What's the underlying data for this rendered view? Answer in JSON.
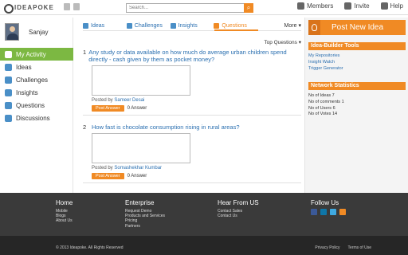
{
  "header": {
    "logo_text": "IDEAPOKE",
    "search_placeholder": "Search...",
    "nav": [
      {
        "label": "Members",
        "icon": "members-icon"
      },
      {
        "label": "Invite",
        "icon": "invite-icon"
      },
      {
        "label": "Help",
        "icon": "help-icon"
      }
    ]
  },
  "sidebar": {
    "username": "Sanjay",
    "items": [
      {
        "label": "My Activity",
        "active": true
      },
      {
        "label": "Ideas"
      },
      {
        "label": "Challenges"
      },
      {
        "label": "Insights"
      },
      {
        "label": "Questions"
      },
      {
        "label": "Discussions"
      }
    ]
  },
  "main": {
    "tabs": [
      "Ideas",
      "Challenges",
      "Insights",
      "Questions",
      "More"
    ],
    "selected_tab": "Questions",
    "sort_label": "Top Questions",
    "questions": [
      {
        "num": "1",
        "title": "Any study or data available on how much do average urban children spend directly - cash given by them as pocket money?",
        "posted_prefix": "Posted by",
        "author": "Sameer Desai",
        "button": "Post Answer",
        "answers": "0 Answer"
      },
      {
        "num": "2",
        "title": "How fast is chocolate consumption rising in rural areas?",
        "posted_prefix": "Posted by",
        "author": "Somashekhar Kumbar",
        "button": "Post Answer",
        "answers": "0 Answer"
      }
    ]
  },
  "right": {
    "post_button": "Post New Idea",
    "tools_title": "Idea-Builder Tools",
    "tools": [
      "My Repositories",
      "Insight Watch",
      "Trigger Generator"
    ],
    "stats_title": "Network Statistics",
    "stats": [
      "No of Ideas 7",
      "No of comments 1",
      "No of Users 6",
      "No of Votes 14"
    ]
  },
  "footer": {
    "home": {
      "title": "Home",
      "links": [
        "Mobile",
        "Blogs",
        "About Us"
      ]
    },
    "enterprise": {
      "title": "Enterprise",
      "links": [
        "Request Demo",
        "Products and Services",
        "Pricing",
        "Partners"
      ]
    },
    "hear": {
      "title": "Hear From US",
      "links": [
        "Contact Sales",
        "Contact Us"
      ]
    },
    "follow": {
      "title": "Follow Us",
      "social": [
        "facebook-icon",
        "linkedin-icon",
        "twitter-icon",
        "rss-icon"
      ]
    },
    "copyright": "© 2013 Ideapoke. All Rights Reserved",
    "privacy": "Privacy Policy",
    "terms": "Terms of Use"
  },
  "colors": {
    "accent": "#f08a24",
    "active_green": "#7cb842",
    "link_blue": "#2a6fb0",
    "footer_bg": "#3a3a3a"
  }
}
